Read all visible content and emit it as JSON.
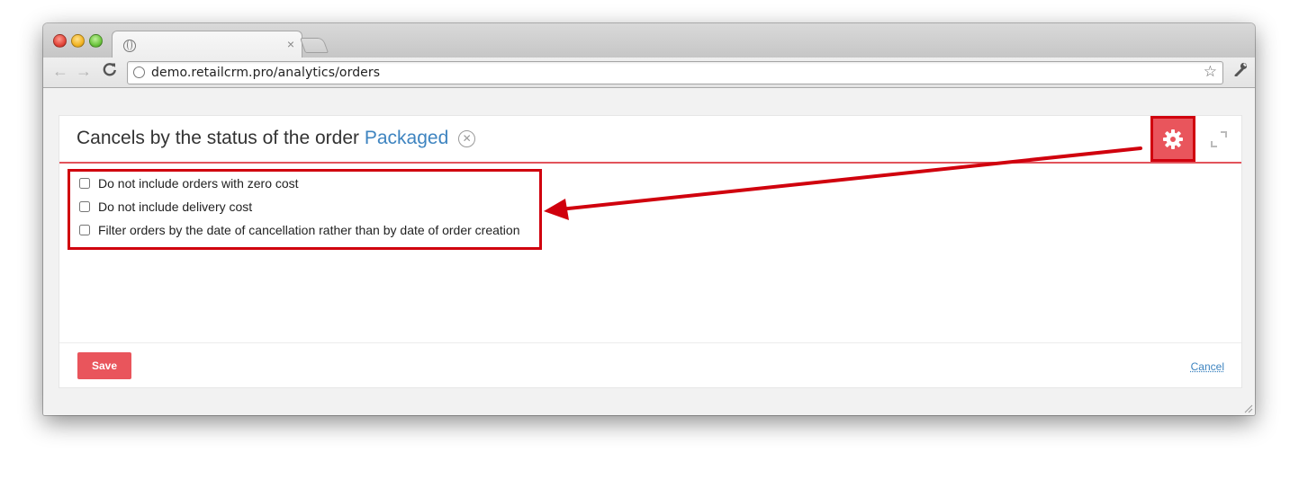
{
  "browser": {
    "tab_close": "×",
    "nav_back": "←",
    "nav_forward": "→",
    "nav_reload": "C",
    "url": "demo.retailcrm.pro/analytics/orders",
    "star": "☆",
    "wrench": "🔧"
  },
  "panel": {
    "title": "Cancels by the status of the order",
    "status_filter": "Packaged",
    "clear_symbol": "✕"
  },
  "options": [
    {
      "label": "Do not include orders with zero cost",
      "checked": false
    },
    {
      "label": "Do not include delivery cost",
      "checked": false
    },
    {
      "label": "Filter orders by the date of cancellation rather than by date of order creation",
      "checked": false
    }
  ],
  "footer": {
    "save_label": "Save",
    "cancel_label": "Cancel"
  },
  "icons": {
    "settings": "gear-icon",
    "expand": "expand-icon",
    "annotation_arrow": "arrow-icon"
  },
  "colors": {
    "accent": "#e9555c",
    "highlight": "#d0000d",
    "link": "#3e84c0"
  }
}
